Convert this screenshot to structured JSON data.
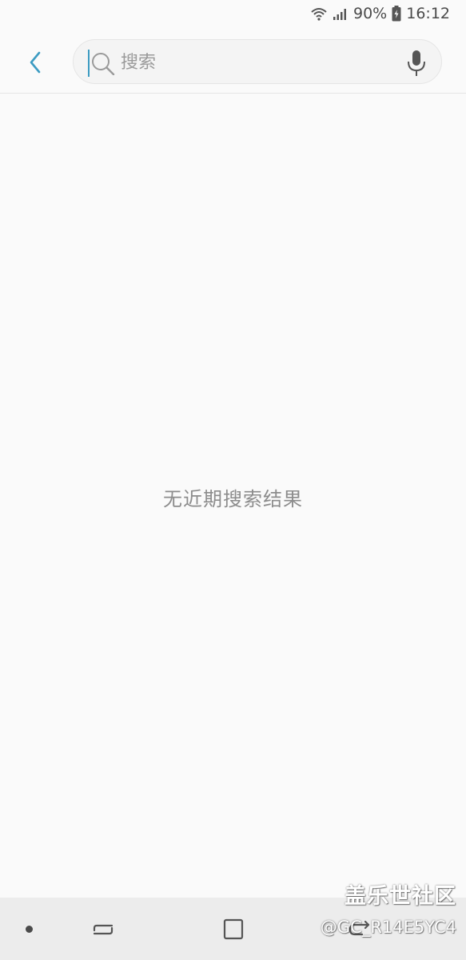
{
  "status_bar": {
    "battery": "90%",
    "time": "16:12",
    "icons": [
      "wifi-icon",
      "signal-icon",
      "battery-charging-icon"
    ]
  },
  "header": {
    "back_icon": "chevron-left-icon",
    "search": {
      "placeholder": "搜索",
      "value": "",
      "search_icon": "search-icon",
      "voice_icon": "microphone-icon"
    }
  },
  "main": {
    "empty_message": "无近期搜索结果"
  },
  "nav_bar": {
    "buttons": [
      "recent-apps-icon",
      "home-icon",
      "back-icon"
    ]
  },
  "watermark": {
    "title": "盖乐世社区",
    "user": "@GC_R14E5YC4"
  },
  "colors": {
    "accent": "#3c9bc2",
    "background": "#fafafa",
    "nav_background": "#ececec",
    "muted_text": "#8c8c8c"
  }
}
